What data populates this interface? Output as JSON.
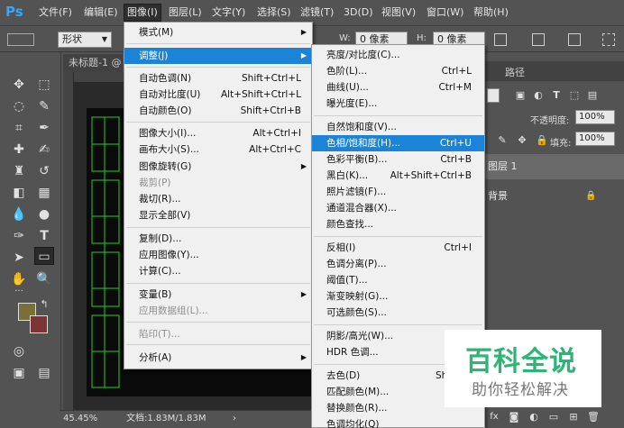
{
  "app": {
    "logo": "Ps"
  },
  "menubar": [
    "文件(F)",
    "编辑(E)",
    "图像(I)",
    "图层(L)",
    "文字(Y)",
    "选择(S)",
    "滤镜(T)",
    "3D(D)",
    "视图(V)",
    "窗口(W)",
    "帮助(H)"
  ],
  "options": {
    "shape_mode": "形状",
    "w_label": "W:",
    "w_value": "0 像素",
    "h_label": "H:",
    "h_value": "0 像素"
  },
  "document": {
    "tab_title": "未标题-1 @",
    "zoom": "45.45%",
    "doc_info": "文档:1.83M/1.83M"
  },
  "image_menu": [
    {
      "label": "模式(M)",
      "shortcut": "",
      "submenu": true
    },
    {
      "label": "调整(J)",
      "shortcut": "",
      "submenu": true,
      "highlight": true
    },
    {
      "label": "自动色调(N)",
      "shortcut": "Shift+Ctrl+L"
    },
    {
      "label": "自动对比度(U)",
      "shortcut": "Alt+Shift+Ctrl+L"
    },
    {
      "label": "自动颜色(O)",
      "shortcut": "Shift+Ctrl+B"
    },
    {
      "label": "图像大小(I)...",
      "shortcut": "Alt+Ctrl+I"
    },
    {
      "label": "画布大小(S)...",
      "shortcut": "Alt+Ctrl+C"
    },
    {
      "label": "图像旋转(G)",
      "shortcut": "",
      "submenu": true
    },
    {
      "label": "裁剪(P)",
      "shortcut": "",
      "disabled": true
    },
    {
      "label": "裁切(R)...",
      "shortcut": ""
    },
    {
      "label": "显示全部(V)",
      "shortcut": ""
    },
    {
      "label": "复制(D)...",
      "shortcut": ""
    },
    {
      "label": "应用图像(Y)...",
      "shortcut": ""
    },
    {
      "label": "计算(C)...",
      "shortcut": ""
    },
    {
      "label": "变量(B)",
      "shortcut": "",
      "submenu": true
    },
    {
      "label": "应用数据组(L)...",
      "shortcut": "",
      "disabled": true
    },
    {
      "label": "陷印(T)...",
      "shortcut": "",
      "disabled": true
    },
    {
      "label": "分析(A)",
      "shortcut": "",
      "submenu": true
    }
  ],
  "adjust_menu": [
    {
      "label": "亮度/对比度(C)...",
      "shortcut": ""
    },
    {
      "label": "色阶(L)...",
      "shortcut": "Ctrl+L"
    },
    {
      "label": "曲线(U)...",
      "shortcut": "Ctrl+M"
    },
    {
      "label": "曝光度(E)...",
      "shortcut": ""
    },
    {
      "label": "自然饱和度(V)...",
      "shortcut": ""
    },
    {
      "label": "色相/饱和度(H)...",
      "shortcut": "Ctrl+U",
      "highlight": true
    },
    {
      "label": "色彩平衡(B)...",
      "shortcut": "Ctrl+B"
    },
    {
      "label": "黑白(K)...",
      "shortcut": "Alt+Shift+Ctrl+B"
    },
    {
      "label": "照片滤镜(F)...",
      "shortcut": ""
    },
    {
      "label": "通道混合器(X)...",
      "shortcut": ""
    },
    {
      "label": "颜色查找...",
      "shortcut": ""
    },
    {
      "label": "反相(I)",
      "shortcut": "Ctrl+I"
    },
    {
      "label": "色调分离(P)...",
      "shortcut": ""
    },
    {
      "label": "阈值(T)...",
      "shortcut": ""
    },
    {
      "label": "渐变映射(G)...",
      "shortcut": ""
    },
    {
      "label": "可选颜色(S)...",
      "shortcut": ""
    },
    {
      "label": "阴影/高光(W)...",
      "shortcut": ""
    },
    {
      "label": "HDR 色调...",
      "shortcut": ""
    },
    {
      "label": "去色(D)",
      "shortcut": "Shift+C"
    },
    {
      "label": "匹配颜色(M)...",
      "shortcut": ""
    },
    {
      "label": "替换颜色(R)...",
      "shortcut": ""
    },
    {
      "label": "色调均化(Q)",
      "shortcut": ""
    }
  ],
  "right_panel": {
    "tab": "路径",
    "opacity_label": "不透明度:",
    "opacity_value": "100%",
    "fill_label": "填充:",
    "fill_value": "100%",
    "layers": [
      "图层 1",
      "背景"
    ]
  },
  "watermark": {
    "title": "百科全说",
    "subtitle": "助你轻松解决"
  }
}
